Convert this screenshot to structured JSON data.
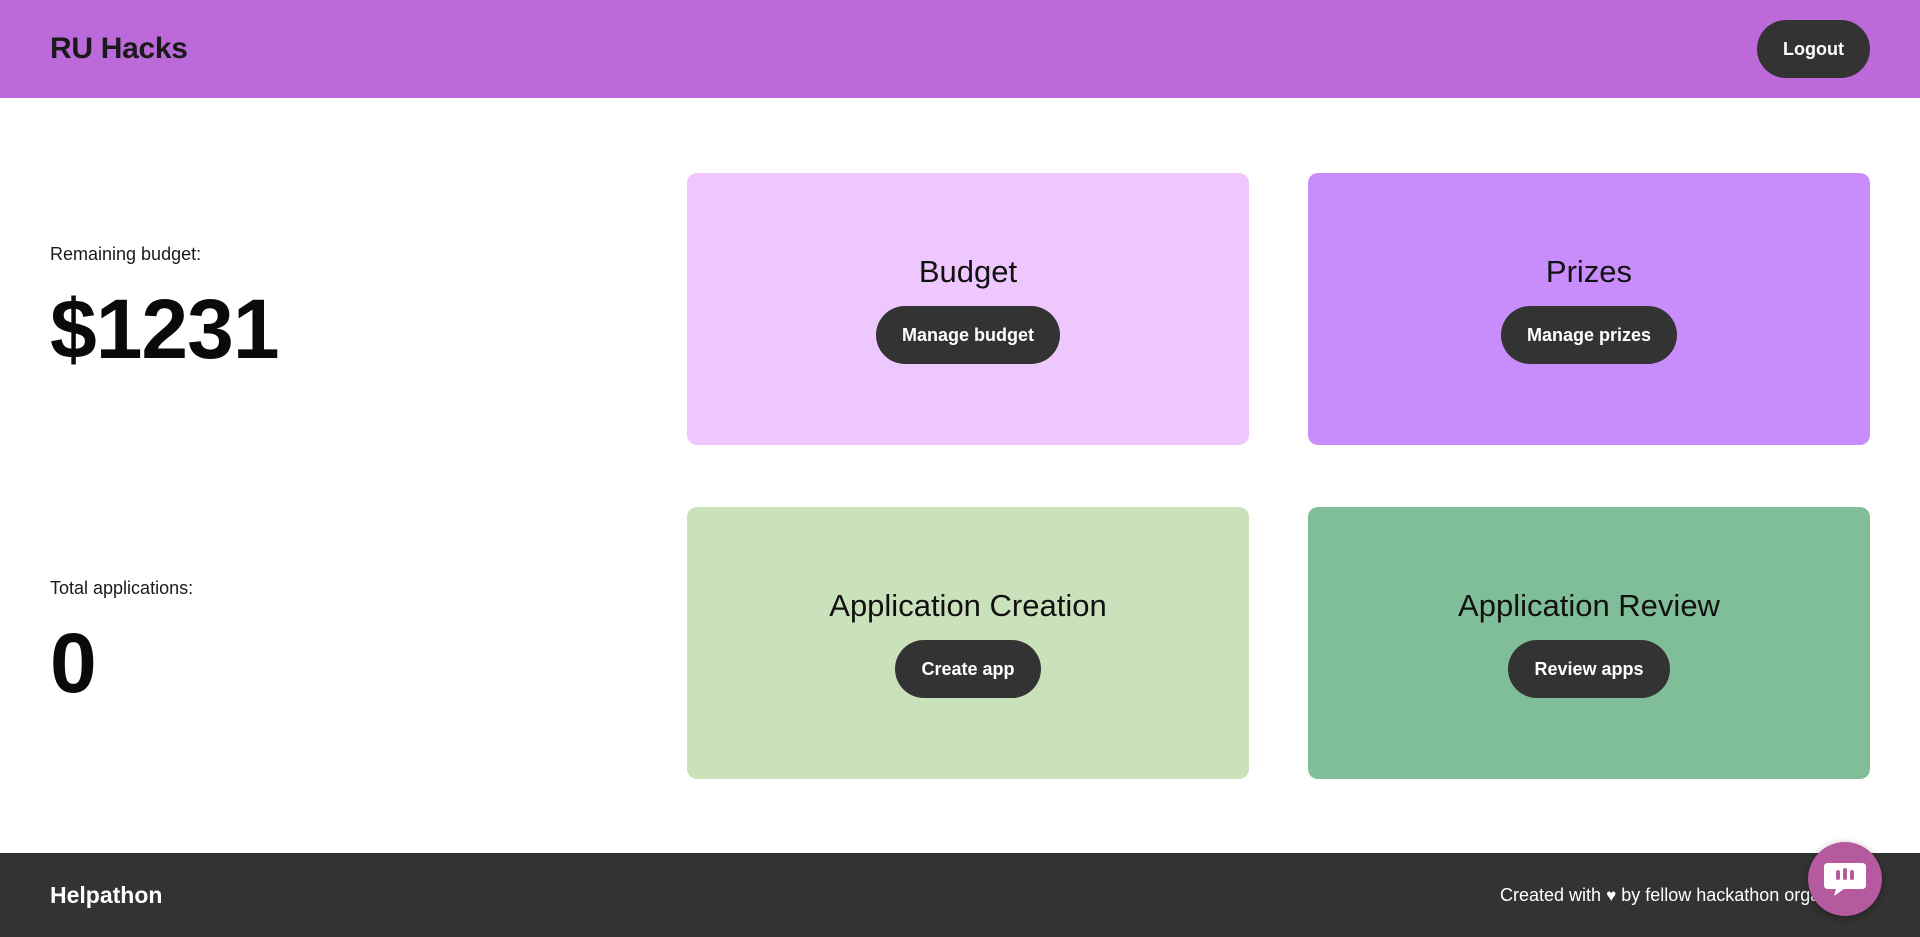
{
  "header": {
    "title": "RU Hacks",
    "logout_label": "Logout",
    "background": "#bc69d9"
  },
  "stats": {
    "budget": {
      "label": "Remaining budget:",
      "value": "$1231"
    },
    "applications": {
      "label": "Total applications:",
      "value": "0"
    }
  },
  "cards": {
    "budget": {
      "title": "Budget",
      "button": "Manage budget",
      "color": "#efc7ff"
    },
    "prizes": {
      "title": "Prizes",
      "button": "Manage prizes",
      "color": "#c88dfb"
    },
    "create": {
      "title": "Application Creation",
      "button": "Create app",
      "color": "#c9e2bb"
    },
    "review": {
      "title": "Application Review",
      "button": "Review apps",
      "color": "#80be9a"
    }
  },
  "footer": {
    "brand": "Helpathon",
    "credit_prefix": "Created with",
    "credit_icon": "heart-icon",
    "credit_suffix": "by fellow hackathon orga"
  },
  "chat": {
    "icon": "chat-bubble-icon",
    "color": "#b55a9e"
  }
}
